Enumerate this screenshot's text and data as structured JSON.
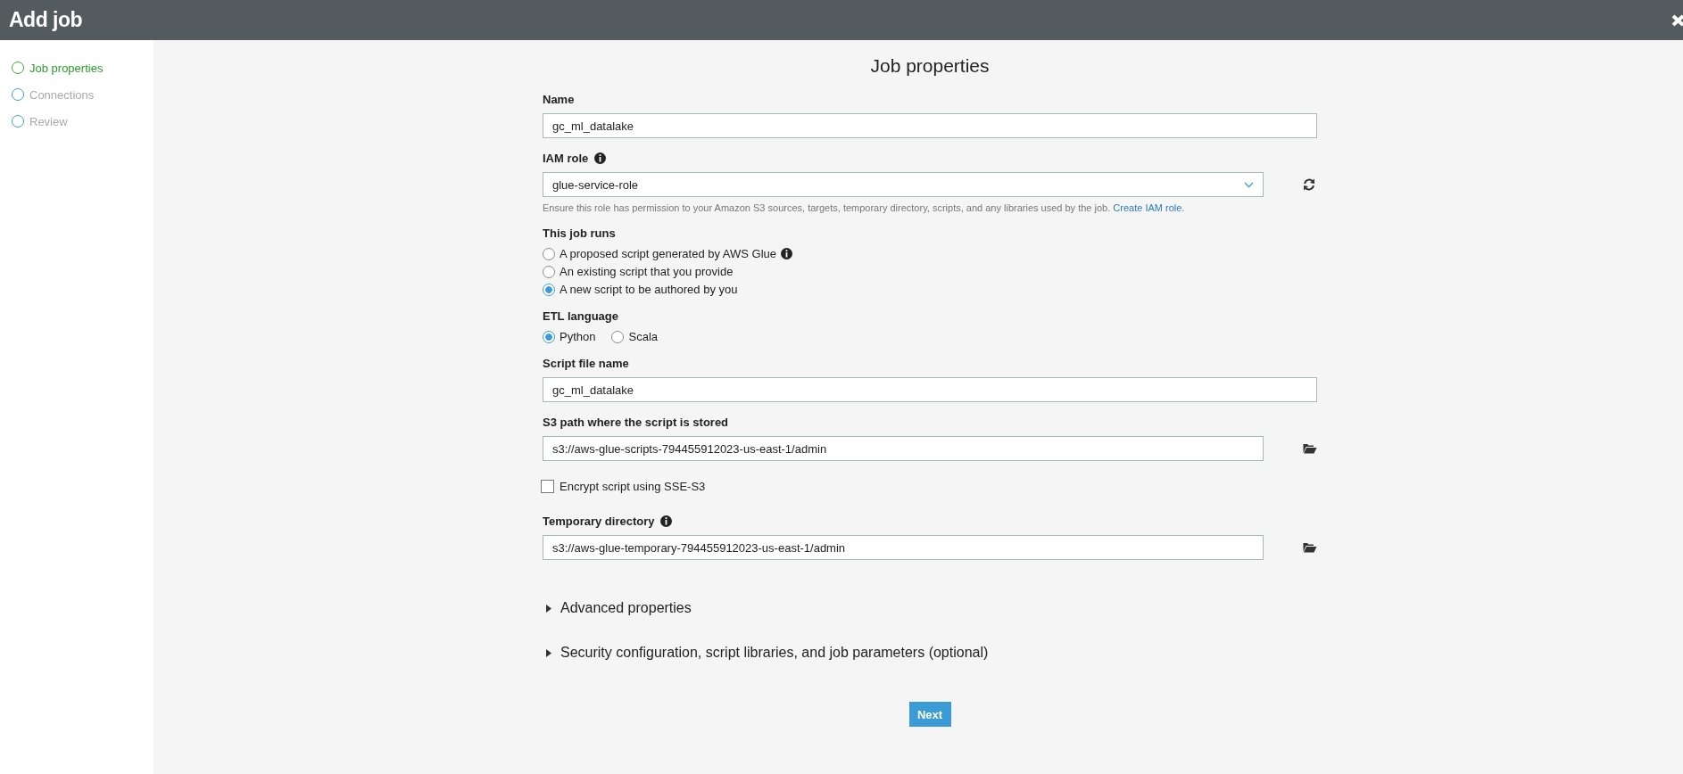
{
  "window": {
    "title": "Add job"
  },
  "steps": [
    {
      "label": "Job properties",
      "selected": true
    },
    {
      "label": "Connections",
      "selected": false
    },
    {
      "label": "Review",
      "selected": false
    }
  ],
  "page_title": "Job properties",
  "form": [
    {
      "kind": "text",
      "label": "Name",
      "value": "gc_ml_datalake"
    },
    {
      "kind": "select",
      "label": "IAM role",
      "info": true,
      "value": "glue-service-role",
      "refresh_button": true,
      "help": "Ensure this role has permission to your Amazon S3 sources, targets, temporary directory, scripts, and any libraries used by the job.",
      "help_link": "Create IAM role."
    },
    {
      "kind": "radio",
      "label": "This job runs",
      "options": [
        {
          "label": "A proposed script generated by AWS Glue",
          "selected": false,
          "info": true
        },
        {
          "label": "An existing script that you provide",
          "selected": false
        },
        {
          "label": "A new script to be authored by you",
          "selected": true
        }
      ]
    },
    {
      "kind": "radiorow",
      "label": "ETL language",
      "options": [
        {
          "label": "Python",
          "selected": true
        },
        {
          "label": "Scala",
          "selected": false
        }
      ]
    },
    {
      "kind": "text",
      "label": "Script file name",
      "value": "gc_ml_datalake"
    },
    {
      "kind": "text",
      "label": "S3 path where the script is stored",
      "value": "s3://aws-glue-scripts-794455912023-us-east-1/admin",
      "browse_button": true
    },
    {
      "kind": "checkbox",
      "label": "Encrypt script using SSE-S3",
      "checked": false
    },
    {
      "kind": "text",
      "label": "Temporary directory",
      "info": true,
      "value": "s3://aws-glue-temporary-794455912023-us-east-1/admin",
      "browse_button": true
    }
  ],
  "sections": [
    {
      "label": "Advanced properties",
      "expanded": false
    },
    {
      "label": "Security configuration, script libraries, and job parameters (optional)",
      "expanded": false
    }
  ],
  "next_button": "Next"
}
